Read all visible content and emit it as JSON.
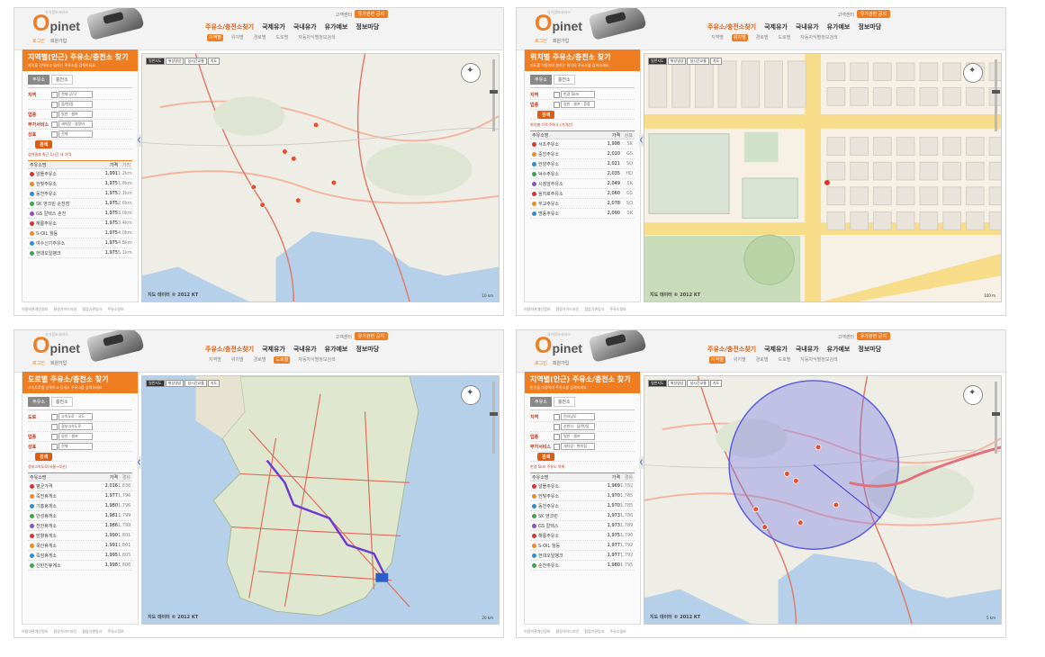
{
  "common": {
    "logo_o": "O",
    "logo_rest": "pinet",
    "logo_tag": "유가정보서비스",
    "sublinks": [
      "로그인",
      "회원가입"
    ],
    "login": "고객센터",
    "badge": "유가관련 공지",
    "main_nav": [
      "주유소/충전소찾기",
      "국제유가",
      "국내유가",
      "유가예보",
      "정보마당"
    ],
    "sub_nav": [
      "지역별",
      "위치별",
      "경로별",
      "도로별",
      "자동차식별정보검색"
    ],
    "map_copyright": "지도 데이터 © 2012 KT",
    "footer_links": [
      "이용약관개인정보",
      "환경가이드라인",
      "협업기관링크",
      "주유소정보"
    ],
    "accent_color": "#ef7d22",
    "collapse_glyph": "❮"
  },
  "panels": [
    {
      "id": "regional",
      "active_nav": 0,
      "active_sub": 0,
      "sidebar_title": "지역별(인근) 주유소/충전소 찾기",
      "sidebar_desc": "지역을 선택하고 원하는 주유소를 검색하세요",
      "tabs": [
        "주유소",
        "충전소"
      ],
      "form": [
        {
          "label": "지역",
          "value": "전체·군/구"
        },
        {
          "label": "",
          "value": "읍/면/동"
        },
        {
          "label": "업종",
          "value": "일반 · 셀프"
        },
        {
          "label": "부가서비스",
          "value": "세차장 · 경정비"
        },
        {
          "label": "상표",
          "value": "전체"
        }
      ],
      "search_label": "검색",
      "note": "검색결과 최근 1시간 내 가격",
      "columns": [
        "주유소명",
        "가격",
        "거리"
      ],
      "rows": [
        {
          "name": "알뜰주유소",
          "price": "1,991",
          "extra": "1.2km"
        },
        {
          "name": "한빛주유소",
          "price": "1,975",
          "extra": "1.8km"
        },
        {
          "name": "동천주유소",
          "price": "1,975",
          "extra": "2.1km"
        },
        {
          "name": "SK 엔크린 순천점",
          "price": "1,975",
          "extra": "2.6km"
        },
        {
          "name": "GS 칼텍스 순천",
          "price": "1,975",
          "extra": "3.0km"
        },
        {
          "name": "해룡주유소",
          "price": "1,975",
          "extra": "3.4km"
        },
        {
          "name": "S-OIL 월등",
          "price": "1,975",
          "extra": "4.0km"
        },
        {
          "name": "여수신기주유소",
          "price": "1,975",
          "extra": "4.8km"
        },
        {
          "name": "현대오일뱅크",
          "price": "1,975",
          "extra": "5.1km"
        }
      ],
      "map_tools": [
        "일반지도",
        "위성영상",
        "실시간교통",
        "지도"
      ],
      "scale": "10 km",
      "map_type": "regional"
    },
    {
      "id": "location",
      "active_nav": 0,
      "active_sub": 1,
      "sidebar_title": "위치별 주유소/충전소 찾기",
      "sidebar_desc": "지도를 이동하여 원하는 위치의 주유소를 검색하세요",
      "tabs": [
        "주유소",
        "충전소"
      ],
      "form": [
        {
          "label": "지역",
          "value": "반경 1km"
        },
        {
          "label": "업종",
          "value": "일반 · 셀프 · 혼합"
        }
      ],
      "search_label": "검색",
      "note": "위치별 가격 주유소 (가격순)",
      "columns": [
        "주유소명",
        "가격",
        "상표"
      ],
      "rows": [
        {
          "name": "서초주유소",
          "price": "1,998",
          "extra": "SK"
        },
        {
          "name": "중앙주유소",
          "price": "2,010",
          "extra": "GS"
        },
        {
          "name": "한양주유소",
          "price": "2,021",
          "extra": "SO"
        },
        {
          "name": "덕수주유소",
          "price": "2,035",
          "extra": "HD"
        },
        {
          "name": "시청앞주유소",
          "price": "2,049",
          "extra": "SK"
        },
        {
          "name": "을지로주유소",
          "price": "2,060",
          "extra": "GS"
        },
        {
          "name": "무교주유소",
          "price": "2,078",
          "extra": "SO"
        },
        {
          "name": "명동주유소",
          "price": "2,090",
          "extra": "SK"
        }
      ],
      "map_tools": [
        "일반지도",
        "위성영상",
        "실시간교통",
        "지도"
      ],
      "scale": "100 m",
      "map_type": "city"
    },
    {
      "id": "road",
      "active_nav": 0,
      "active_sub": 3,
      "sidebar_title": "도로별 주유소/충전소 찾기",
      "sidebar_desc": "고속도로를 선택하고 휴게소 주유소를 검색하세요",
      "tabs": [
        "주유소",
        "충전소"
      ],
      "form": [
        {
          "label": "도로",
          "value": "고속도로 · 국도"
        },
        {
          "label": "",
          "value": "경부고속도로"
        },
        {
          "label": "업종",
          "value": "일반 · 셀프"
        },
        {
          "label": "상표",
          "value": "전체"
        }
      ],
      "search_label": "검색",
      "note": "경부고속도로(서울→부산)",
      "columns": [
        "주유소명",
        "가격",
        "경유"
      ],
      "rows": [
        {
          "name": "평균가격",
          "price": "2,016",
          "extra": "1,836"
        },
        {
          "name": "죽전휴게소",
          "price": "1,977",
          "extra": "1,796"
        },
        {
          "name": "기흥휴게소",
          "price": "1,980",
          "extra": "1,796"
        },
        {
          "name": "안성휴게소",
          "price": "1,981",
          "extra": "1,799"
        },
        {
          "name": "천안휴게소",
          "price": "1,986",
          "extra": "1,799"
        },
        {
          "name": "망향휴게소",
          "price": "1,990",
          "extra": "1,801"
        },
        {
          "name": "옥산휴게소",
          "price": "1,991",
          "extra": "1,801"
        },
        {
          "name": "죽암휴게소",
          "price": "1,995",
          "extra": "1,805"
        },
        {
          "name": "신탄진휴게소",
          "price": "1,998",
          "extra": "1,806"
        }
      ],
      "map_tools": [
        "일반지도",
        "위성영상",
        "실시간교통",
        "지도"
      ],
      "scale": "20 km",
      "map_type": "korea"
    },
    {
      "id": "radius",
      "active_nav": 0,
      "active_sub": 0,
      "sidebar_title": "지역별(인근) 주유소/충전소 찾기",
      "sidebar_desc": "반경을 지정하여 주유소를 검색하세요",
      "tabs": [
        "주유소",
        "충전소"
      ],
      "form": [
        {
          "label": "지역",
          "value": "전라남도"
        },
        {
          "label": "",
          "value": "순천시 · 읍/면/동"
        },
        {
          "label": "업종",
          "value": "일반 · 셀프"
        },
        {
          "label": "부가서비스",
          "value": "세차장 · 편의점"
        }
      ],
      "search_label": "검색",
      "note": "반경 5km 주유소 목록",
      "columns": [
        "주유소명",
        "가격",
        "경유"
      ],
      "rows": [
        {
          "name": "알뜰주유소",
          "price": "1,969",
          "extra": "1,782"
        },
        {
          "name": "한빛주유소",
          "price": "1,970",
          "extra": "1,785"
        },
        {
          "name": "동천주유소",
          "price": "1,970",
          "extra": "1,785"
        },
        {
          "name": "SK 엔크린",
          "price": "1,973",
          "extra": "1,786"
        },
        {
          "name": "GS 칼텍스",
          "price": "1,973",
          "extra": "1,789"
        },
        {
          "name": "해룡주유소",
          "price": "1,975",
          "extra": "1,790"
        },
        {
          "name": "S-OIL 월등",
          "price": "1,977",
          "extra": "1,792"
        },
        {
          "name": "현대오일뱅크",
          "price": "1,977",
          "extra": "1,792"
        },
        {
          "name": "순천주유소",
          "price": "1,980",
          "extra": "1,795"
        }
      ],
      "map_tools": [
        "일반지도",
        "위성영상",
        "실시간교통",
        "지도"
      ],
      "scale": "5 km",
      "map_type": "radius"
    }
  ],
  "brand_colors": [
    "#e0302b",
    "#f08a24",
    "#2b8fd6",
    "#3aa64a",
    "#8a50c8"
  ]
}
